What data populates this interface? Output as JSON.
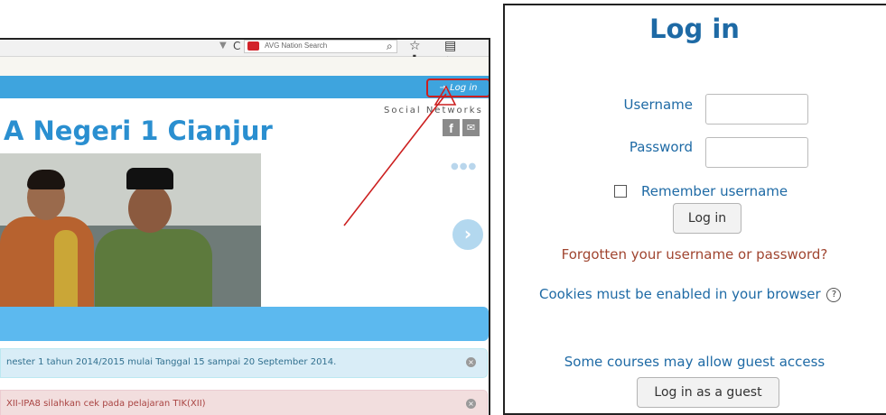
{
  "browser": {
    "search_placeholder": "AVG Nation Search",
    "dropdown_glyph": "▼",
    "reload_glyph": "C",
    "search_glyph": "⌕",
    "toolbar_glyphs": "☆ ▤ ⬇ ⌂",
    "icons": [
      "avg-icon",
      "reload-icon",
      "search-icon",
      "star-icon",
      "bookmarks-icon",
      "download-icon",
      "home-icon"
    ]
  },
  "site": {
    "login_link": "⇥ Log in",
    "social_label": "Social Networks",
    "title": "A Negeri 1 Cianjur",
    "facebook_glyph": "f",
    "twitter_glyph": "✉",
    "slider_dots": "●●●",
    "next_glyph": "›",
    "alerts": [
      {
        "text": "nester 1 tahun 2014/2015 mulai Tanggal 15 sampai 20 September 2014.",
        "close": "×"
      },
      {
        "text": "XII-IPA8 silahkan cek pada pelajaran TIK(XII)",
        "close": "×"
      }
    ]
  },
  "login": {
    "heading": "Log in",
    "username_label": "Username",
    "password_label": "Password",
    "remember_label": "Remember username",
    "login_button": "Log in",
    "forgot_link": "Forgotten your username or password?",
    "cookies_text": "Cookies must be enabled in your browser",
    "help_glyph": "?",
    "guest_text": "Some courses may allow guest access",
    "guest_button": "Log in as a guest"
  },
  "colors": {
    "accent": "#1e6aa5",
    "annotation": "#cc1f1f",
    "nav_bar": "#3ea4de"
  }
}
